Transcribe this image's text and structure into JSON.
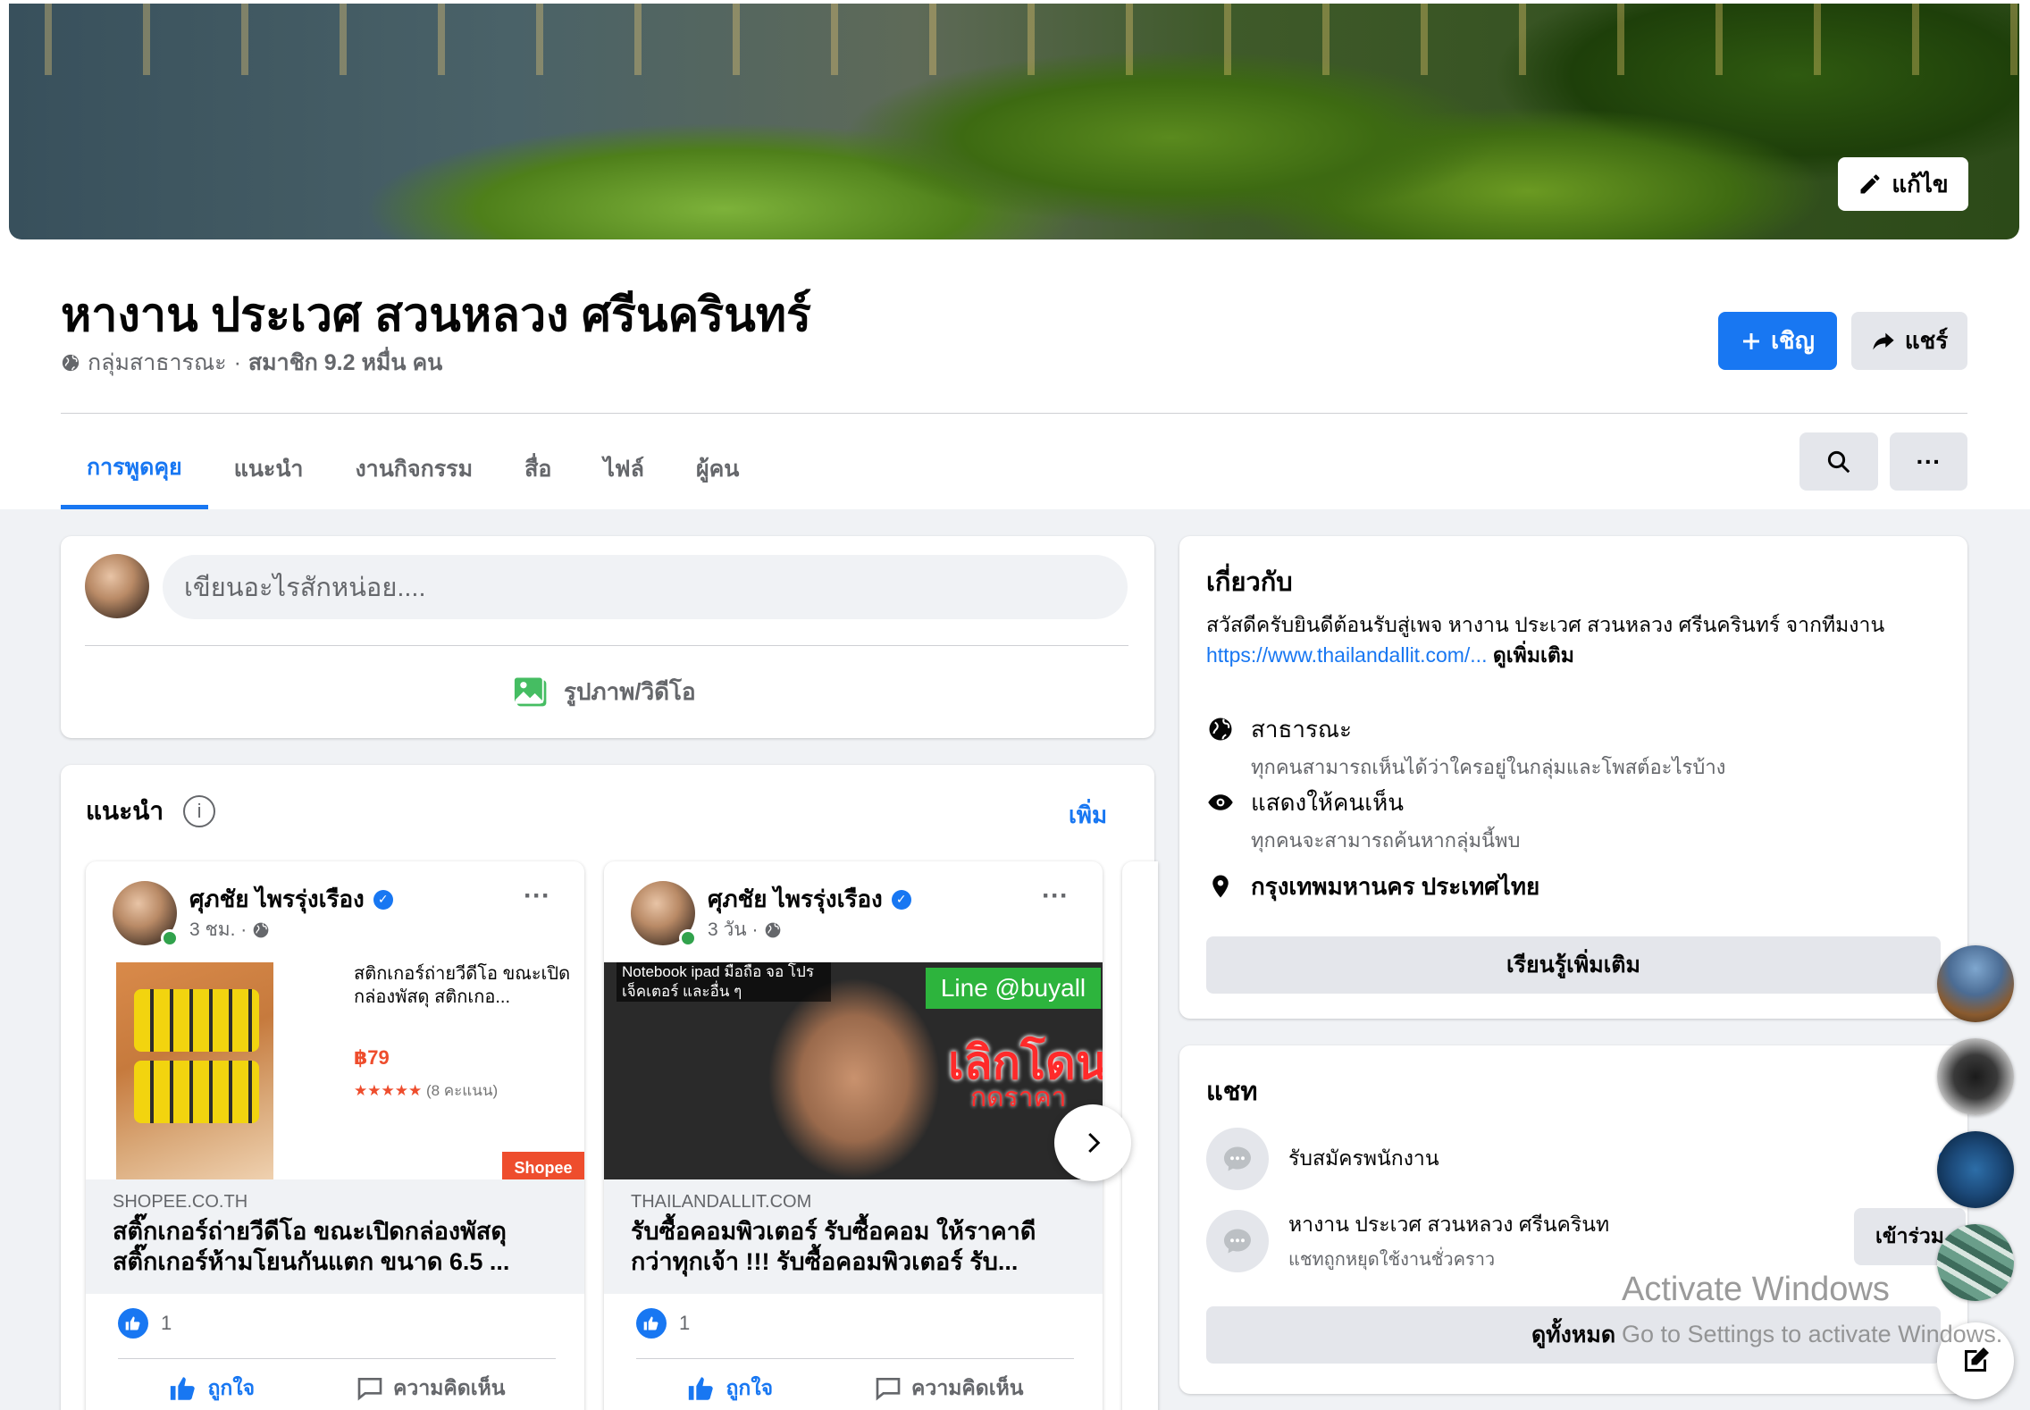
{
  "header": {
    "edit_cover_label": "แก้ไข",
    "group_name": "หางาน ประเวศ สวนหลวง ศรีนครินทร์",
    "privacy": "กลุ่มสาธารณะ",
    "separator": "·",
    "members": "สมาชิก 9.2 หมื่น คน",
    "invite_label": "เชิญ",
    "share_label": "แชร์"
  },
  "tabs": [
    {
      "label": "การพูดคุย",
      "active": true
    },
    {
      "label": "แนะนำ"
    },
    {
      "label": "งานกิจกรรม"
    },
    {
      "label": "สื่อ"
    },
    {
      "label": "ไฟล์"
    },
    {
      "label": "ผู้คน"
    }
  ],
  "composer": {
    "placeholder": "เขียนอะไรสักหน่อย....",
    "photo_video_label": "รูปภาพ/วิดีโอ"
  },
  "suggested": {
    "title": "แนะนำ",
    "more_label": "เพิ่ม",
    "posts": [
      {
        "author": "ศุภชัย ไพรรุ่งเรือง",
        "time": "3 ชม. ·",
        "product_text": "สติกเกอร์ถ่ายวีดีโอ ขณะเปิดกล่องพัสดุ สติกเกอ...",
        "price": "฿79",
        "stars": "★★★★★",
        "rating_count": "(8 คะแนน)",
        "image_badge": "Shopee",
        "domain": "SHOPEE.CO.TH",
        "title": "สติ๊กเกอร์ถ่ายวีดีโอ ขณะเปิดกล่องพัสดุ สติ๊กเกอร์ห้ามโยนกันแตก ขนาด 6.5 ...",
        "reaction_count": "1",
        "like_label": "ถูกใจ",
        "comment_label": "ความคิดเห็น"
      },
      {
        "author": "ศุภชัย ไพรรุ่งเรือง",
        "time": "3 วัน ·",
        "image_caption": "Notebook ipad มือถือ จอ โปรเจ็คเตอร์ และอื่น ๆ",
        "image_line": "Line @buyall",
        "image_red": "เลิกโดน",
        "image_red2": "กดราคา",
        "domain": "THAILANDALLIT.COM",
        "title": "รับซื้อคอมพิวเตอร์ รับซื้อคอม ให้ราคาดีกว่าทุกเจ้า !!! รับซื้อคอมพิวเตอร์ รับ...",
        "reaction_count": "1",
        "like_label": "ถูกใจ",
        "comment_label": "ความคิดเห็น"
      }
    ]
  },
  "about": {
    "title": "เกี่ยวกับ",
    "description": "สวัสดีครับยินดีต้อนรับสู่เพจ หางาน ประเวศ สวนหลวง ศรีนครินทร์ จากทีมงาน",
    "link": "https://www.thailandallit.com/...",
    "see_more": "ดูเพิ่มเติม",
    "public_title": "สาธารณะ",
    "public_sub": "ทุกคนสามารถเห็นได้ว่าใครอยู่ในกลุ่มและโพสต์อะไรบ้าง",
    "visible_title": "แสดงให้คนเห็น",
    "visible_sub": "ทุกคนจะสามารถค้นหากลุ่มนี้พบ",
    "location": "กรุงเทพมหานคร ประเทศไทย",
    "learn_more": "เรียนรู้เพิ่มเติม"
  },
  "chat": {
    "title": "แชท",
    "items": [
      {
        "name": "รับสมัครพนักงาน",
        "sub": ""
      },
      {
        "name": "หางาน ประเวศ สวนหลวง ศรีนครินท",
        "sub": "แชทถูกหยุดใช้งานชั่วคราว",
        "action": "เข้าร่วม"
      }
    ],
    "see_all": "ดูทั้งหมด"
  },
  "watermark": {
    "line1": "Activate Windows",
    "line2": "Go to Settings to activate Windows."
  },
  "colors": {
    "accent": "#1877f2",
    "background": "#f0f2f5",
    "secondary_text": "#65676b"
  }
}
